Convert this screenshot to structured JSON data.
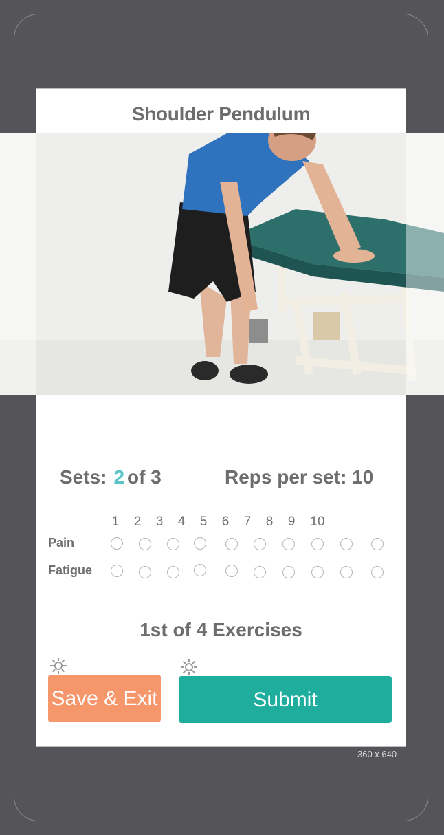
{
  "screen": {
    "title": "Shoulder Pendulum",
    "resolution_label": "360 x 640"
  },
  "photo": {
    "alt": "Man leaning on treatment table with one arm hanging down"
  },
  "sets": {
    "label": "Sets:",
    "current": "2",
    "suffix": "of 3"
  },
  "reps": {
    "label": "Reps per set: 10"
  },
  "rating": {
    "scale": [
      "1",
      "2",
      "3",
      "4",
      "5",
      "6",
      "7",
      "8",
      "9",
      "10"
    ],
    "rows": [
      {
        "label": "Pain"
      },
      {
        "label": "Fatigue"
      }
    ]
  },
  "progress": {
    "label": "1st of 4 Exercises"
  },
  "actions": {
    "save_exit": "Save & Exit",
    "submit": "Submit",
    "gear_icon": "gear-icon"
  },
  "colors": {
    "background": "#545459",
    "accent_teal": "#1fae9e",
    "accent_orange": "#f6966b",
    "current_set": "#5bc4c6"
  }
}
